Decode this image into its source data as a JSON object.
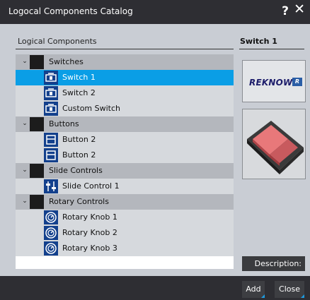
{
  "window": {
    "title": "Logocal Components Catalog",
    "help_label": "?",
    "close_label": "✕"
  },
  "left_header": "Logical Components",
  "right_header": "Switch 1",
  "tree": {
    "groups": [
      {
        "label": "Switches",
        "toggle": "⌄",
        "items": [
          {
            "label": "Switch 1",
            "icon": "switch-icon",
            "selected": true
          },
          {
            "label": "Switch 2",
            "icon": "switch-icon",
            "selected": false
          },
          {
            "label": "Custom Switch",
            "icon": "switch-icon",
            "selected": false
          }
        ]
      },
      {
        "label": "Buttons",
        "toggle": "⌄",
        "items": [
          {
            "label": "Button 2",
            "icon": "button-icon",
            "selected": false
          },
          {
            "label": "Button 2",
            "icon": "button-icon",
            "selected": false
          }
        ]
      },
      {
        "label": "Slide Controls",
        "toggle": "⌄",
        "items": [
          {
            "label": "Slide Control 1",
            "icon": "slider-icon",
            "selected": false
          }
        ]
      },
      {
        "label": "Rotary Controls",
        "toggle": "⌄",
        "items": [
          {
            "label": "Rotary Knob 1",
            "icon": "knob-icon",
            "selected": false
          },
          {
            "label": "Rotary Knob 2",
            "icon": "knob-icon",
            "selected": false
          },
          {
            "label": "Rotary Knob 3",
            "icon": "knob-icon",
            "selected": false
          }
        ]
      }
    ]
  },
  "logo": {
    "text": "REKNOW",
    "mark": "R"
  },
  "description_label": "Description:",
  "footer": {
    "add_label": "Add",
    "close_label": "Close"
  },
  "colors": {
    "selection": "#0a9ee6",
    "icon_bg": "#13408c",
    "accent": "#1e9be0"
  }
}
